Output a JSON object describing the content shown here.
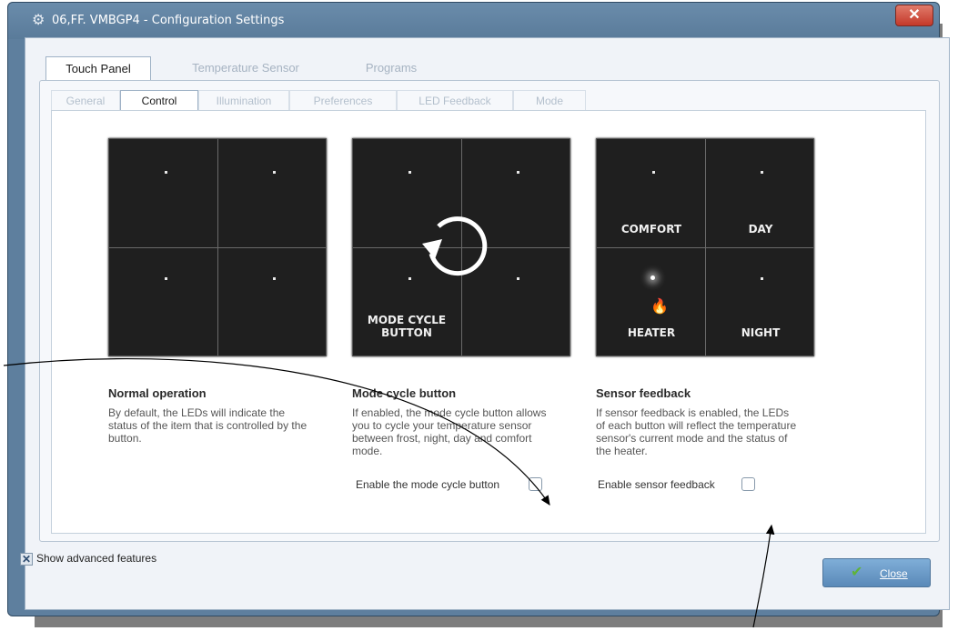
{
  "window": {
    "title": "06,FF. VMBGP4 - Configuration Settings",
    "icon": "gear-icon",
    "close_glyph": "✕"
  },
  "top_tabs": [
    {
      "label": "Touch Panel",
      "active": true
    },
    {
      "label": "Temperature Sensor",
      "active": false
    },
    {
      "label": "Programs",
      "active": false
    }
  ],
  "sub_tabs": [
    {
      "label": "General",
      "active": false
    },
    {
      "label": "Control",
      "active": true
    },
    {
      "label": "Illumination",
      "active": false
    },
    {
      "label": "Preferences",
      "active": false
    },
    {
      "label": "LED Feedback",
      "active": false
    },
    {
      "label": "Mode",
      "active": false
    }
  ],
  "panels": {
    "normal": {
      "title": "Normal operation",
      "description": "By default, the LEDs will indicate the status of the item that is controlled by the button."
    },
    "mode_cycle": {
      "title": "Mode cycle button",
      "description": "If enabled, the mode cycle button allows you to cycle your temperature sensor between frost, night, day and comfort mode.",
      "keypad_label_1": "MODE CYCLE",
      "keypad_label_2": "BUTTON",
      "option_label": "Enable the mode cycle button",
      "checked": false,
      "icon": "cycle-icon"
    },
    "sensor_feedback": {
      "title": "Sensor feedback",
      "description": "If sensor feedback is enabled, the LEDs of each button will reflect the temperature sensor's current mode and the status of the heater.",
      "labels": [
        "COMFORT",
        "DAY",
        "HEATER",
        "NIGHT"
      ],
      "option_label": "Enable sensor feedback",
      "checked": false,
      "icon": "flame-icon"
    }
  },
  "footer": {
    "advanced_label": "Show advanced features",
    "advanced_checked": true,
    "close_label": "Close"
  },
  "colors": {
    "window_frame": "#5e7f9e",
    "keypad": "#1f1f1f",
    "flame": "#e8792a"
  }
}
